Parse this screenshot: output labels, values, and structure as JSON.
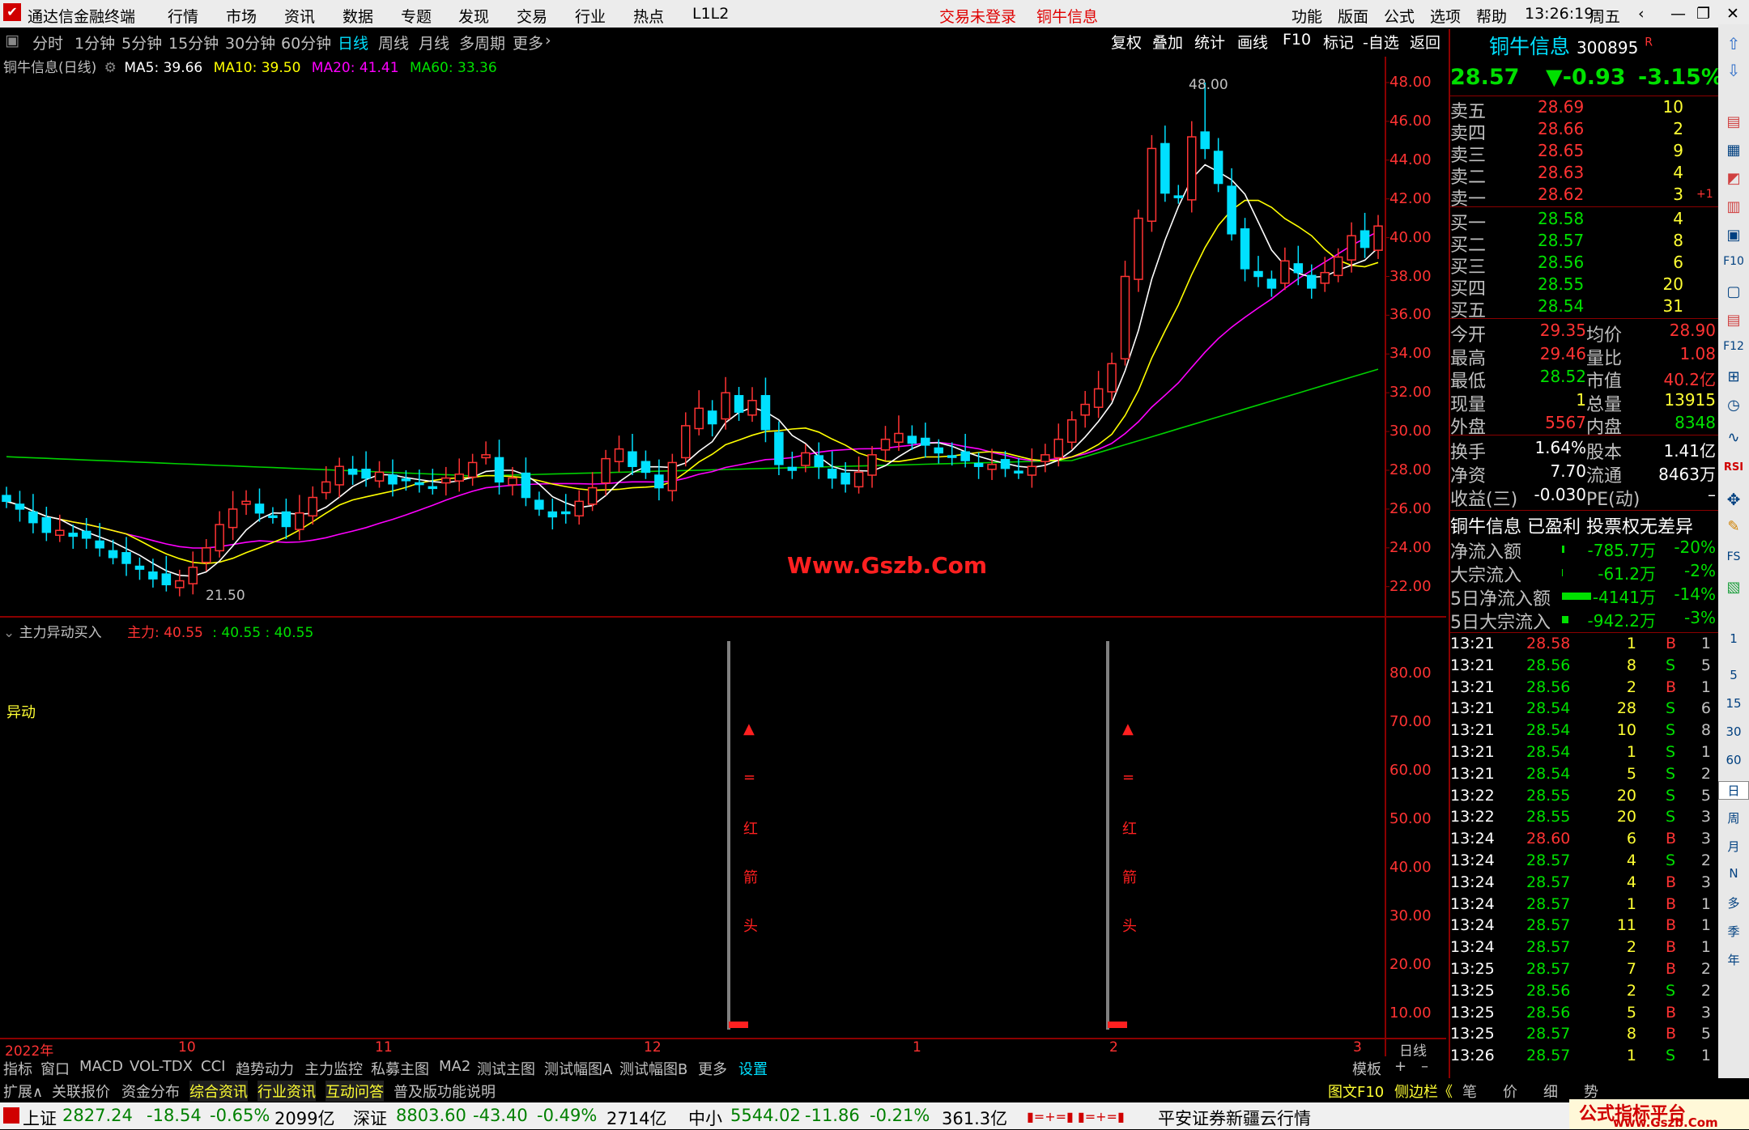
{
  "menubar": {
    "app_title": "通达信金融终端",
    "items": [
      "行情",
      "市场",
      "资讯",
      "数据",
      "专题",
      "发现",
      "交易",
      "行业",
      "热点",
      "L1L2"
    ],
    "notice1": "交易未登录",
    "notice2": "铜牛信息",
    "right_items": [
      "功能",
      "版面",
      "公式",
      "选项",
      "帮助"
    ],
    "time": "13:26:19",
    "weekday": "周五"
  },
  "toolbar": {
    "periods": [
      "分时",
      "1分钟",
      "5分钟",
      "15分钟",
      "30分钟",
      "60分钟",
      "日线",
      "周线",
      "月线",
      "多周期",
      "更多"
    ],
    "active": "日线",
    "right": [
      "复权",
      "叠加",
      "统计",
      "画线",
      "F10",
      "标记",
      "-自选",
      "返回"
    ]
  },
  "main_chart": {
    "title": "铜牛信息(日线)",
    "ma5": "MA5: 39.66",
    "ma10": "MA10: 39.50",
    "ma20": "MA20: 41.41",
    "ma60": "MA60: 33.36",
    "high_label": "48.00",
    "low_label": "21.50",
    "watermark": "Www.Gszb.Com",
    "y_ticks": [
      "48.00",
      "46.00",
      "44.00",
      "42.00",
      "40.00",
      "38.00",
      "36.00",
      "34.00",
      "32.00",
      "30.00",
      "28.00",
      "26.00",
      "24.00",
      "22.00"
    ]
  },
  "sub_chart": {
    "title": "主力异动买入",
    "value_label": "主力: 40.55",
    "extra": ": 40.55 : 40.55",
    "signal": "异动",
    "annotation_chars": [
      "▲",
      "=",
      "红",
      "箭",
      "头"
    ],
    "y_ticks": [
      "80.00",
      "70.00",
      "60.00",
      "50.00",
      "40.00",
      "30.00",
      "20.00",
      "10.00"
    ]
  },
  "x_axis": {
    "labels": [
      "2022年",
      "10",
      "11",
      "12",
      "1",
      "2",
      "3"
    ],
    "period": "日线"
  },
  "chart_data": {
    "type": "candlestick",
    "ylim": [
      21,
      49
    ],
    "high": 48.0,
    "low": 21.5,
    "ma": {
      "MA5": 39.66,
      "MA10": 39.5,
      "MA20": 41.41,
      "MA60": 33.36
    },
    "closes": [
      26.4,
      26.0,
      25.3,
      24.8,
      24.9,
      24.6,
      24.5,
      24.0,
      23.5,
      23.2,
      22.9,
      22.4,
      22.1,
      22.3,
      23.0,
      24.0,
      25.2,
      26.0,
      26.4,
      25.8,
      25.6,
      25.1,
      25.8,
      26.6,
      27.4,
      28.2,
      27.8,
      27.6,
      27.9,
      27.3,
      27.5,
      27.3,
      27.1,
      27.6,
      27.8,
      28.4,
      28.8,
      27.4,
      27.6,
      26.6,
      26.0,
      25.6,
      25.8,
      26.4,
      27.1,
      28.6,
      29.1,
      28.2,
      27.9,
      27.1,
      28.4,
      30.3,
      31.2,
      30.4,
      32.0,
      31.0,
      31.6,
      30.1,
      28.3,
      28.0,
      28.9,
      28.2,
      27.6,
      27.3,
      27.9,
      28.8,
      29.6,
      29.9,
      29.4,
      29.3,
      28.9,
      28.7,
      28.5,
      28.2,
      28.3,
      28.1,
      27.9,
      28.2,
      28.8,
      29.6,
      30.6,
      31.4,
      32.2,
      33.5,
      38.0,
      41.0,
      44.6,
      42.3,
      42.1,
      45.2,
      44.6,
      42.8,
      40.2,
      38.4,
      38.0,
      37.4,
      38.8,
      38.2,
      37.4,
      38.2,
      39.0,
      40.1,
      39.5,
      40.6
    ]
  },
  "quote": {
    "name": "铜牛信息",
    "code": "300895",
    "r_mark": "R",
    "price": "28.57",
    "change": "▼-0.93",
    "pct": "-3.15%",
    "asks": [
      {
        "l": "卖五",
        "p": "28.69",
        "v": "10"
      },
      {
        "l": "卖四",
        "p": "28.66",
        "v": "2"
      },
      {
        "l": "卖三",
        "p": "28.65",
        "v": "9"
      },
      {
        "l": "卖二",
        "p": "28.63",
        "v": "4"
      },
      {
        "l": "卖一",
        "p": "28.62",
        "v": "3"
      }
    ],
    "ask_extra": "+1",
    "bids": [
      {
        "l": "买一",
        "p": "28.58",
        "v": "4"
      },
      {
        "l": "买二",
        "p": "28.57",
        "v": "8"
      },
      {
        "l": "买三",
        "p": "28.56",
        "v": "6"
      },
      {
        "l": "买四",
        "p": "28.55",
        "v": "20"
      },
      {
        "l": "买五",
        "p": "28.54",
        "v": "31"
      }
    ],
    "stats": [
      [
        "今开",
        "29.35",
        "均价",
        "28.90"
      ],
      [
        "最高",
        "29.46",
        "量比",
        "1.08"
      ],
      [
        "最低",
        "28.52",
        "市值",
        "40.2亿"
      ],
      [
        "现量",
        "1",
        "总量",
        "13915"
      ],
      [
        "外盘",
        "5567",
        "内盘",
        "8348"
      ]
    ],
    "stats2": [
      [
        "换手",
        "1.64%",
        "股本",
        "1.41亿"
      ],
      [
        "净资",
        "7.70",
        "流通",
        "8463万"
      ],
      [
        "收益(三)",
        "-0.030",
        "PE(动)",
        "–"
      ]
    ],
    "notice": "铜牛信息 已盈利 投票权无差异",
    "flows": [
      [
        "净流入额",
        "-785.7万",
        "-20%"
      ],
      [
        "大宗流入",
        "-61.2万",
        "-2%"
      ],
      [
        "5日净流入额",
        "-4141万",
        "-14%"
      ],
      [
        "5日大宗流入",
        "-942.2万",
        "-3%"
      ]
    ],
    "ticks": [
      [
        "13:21",
        "28.58",
        "1",
        "B",
        "1"
      ],
      [
        "13:21",
        "28.56",
        "8",
        "S",
        "5"
      ],
      [
        "13:21",
        "28.56",
        "2",
        "B",
        "1"
      ],
      [
        "13:21",
        "28.54",
        "28",
        "S",
        "6"
      ],
      [
        "13:21",
        "28.54",
        "10",
        "S",
        "8"
      ],
      [
        "13:21",
        "28.54",
        "1",
        "S",
        "1"
      ],
      [
        "13:21",
        "28.54",
        "5",
        "S",
        "2"
      ],
      [
        "13:22",
        "28.55",
        "20",
        "S",
        "5"
      ],
      [
        "13:22",
        "28.55",
        "20",
        "S",
        "3"
      ],
      [
        "13:24",
        "28.60",
        "6",
        "B",
        "3"
      ],
      [
        "13:24",
        "28.57",
        "4",
        "S",
        "2"
      ],
      [
        "13:24",
        "28.57",
        "4",
        "B",
        "3"
      ],
      [
        "13:24",
        "28.57",
        "1",
        "B",
        "1"
      ],
      [
        "13:24",
        "28.57",
        "11",
        "B",
        "1"
      ],
      [
        "13:24",
        "28.57",
        "2",
        "B",
        "1"
      ],
      [
        "13:25",
        "28.57",
        "7",
        "B",
        "2"
      ],
      [
        "13:25",
        "28.56",
        "2",
        "S",
        "2"
      ],
      [
        "13:25",
        "28.56",
        "5",
        "B",
        "3"
      ],
      [
        "13:25",
        "28.57",
        "8",
        "B",
        "5"
      ],
      [
        "13:26",
        "28.57",
        "1",
        "S",
        "1"
      ]
    ]
  },
  "bottom_tabs": [
    "指标",
    "窗口",
    "MACD",
    "VOL-TDX",
    "CCI",
    "趋势动力",
    "主力监控",
    "私募主图",
    "MA2",
    "测试主图",
    "测试幅图A",
    "测试幅图B",
    "更多",
    "设置"
  ],
  "bottom_right": [
    "模板",
    "+",
    "–"
  ],
  "tabs2": [
    "扩展∧",
    "关联报价",
    "资金分布",
    "综合资讯",
    "行业资讯",
    "互动问答",
    "普及版功能说明"
  ],
  "tabs2_right": [
    "图文F10",
    "侧边栏《",
    "笔",
    "价",
    "细",
    "势"
  ],
  "status": {
    "sh_name": "上证",
    "sh": "2827.24",
    "sh_chg": "-18.54",
    "sh_pct": "-0.65%",
    "sh_amt": "2099亿",
    "sz_name": "深证",
    "sz": "8803.60",
    "sz_chg": "-43.40",
    "sz_pct": "-0.49%",
    "sz_amt": "2714亿",
    "zx_name": "中小",
    "zx": "5544.02",
    "zx_chg": "-11.86",
    "zx_pct": "-0.21%",
    "zx_amt": "361.3亿",
    "broker": "平安证券新疆云行情",
    "badge": "公式指标平台",
    "badge_url": "www.Gszb.Com"
  },
  "sidebar_items": [
    "1",
    "5",
    "15",
    "30",
    "60",
    "日",
    "周",
    "月",
    "N",
    "多",
    "季",
    "年"
  ]
}
